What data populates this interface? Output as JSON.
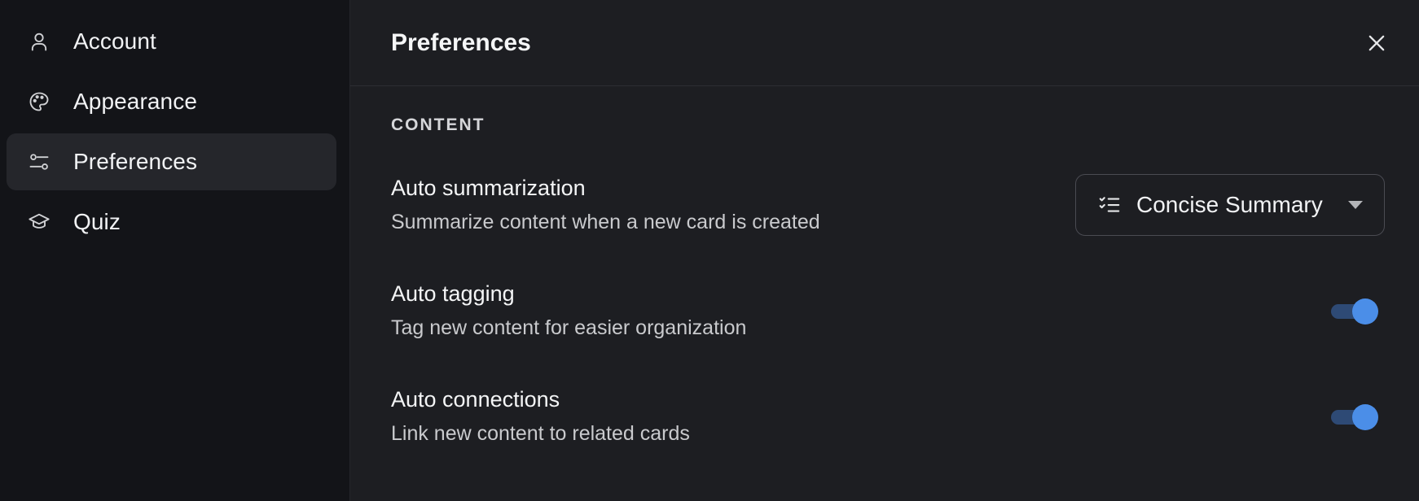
{
  "sidebar": {
    "items": [
      {
        "label": "Account",
        "icon": "user-icon",
        "active": false
      },
      {
        "label": "Appearance",
        "icon": "palette-icon",
        "active": false
      },
      {
        "label": "Preferences",
        "icon": "sliders-icon",
        "active": true
      },
      {
        "label": "Quiz",
        "icon": "graduation-cap-icon",
        "active": false
      }
    ]
  },
  "header": {
    "title": "Preferences",
    "close_icon": "close-icon"
  },
  "content": {
    "section_label": "CONTENT",
    "settings": [
      {
        "title": "Auto summarization",
        "description": "Summarize content when a new card is created",
        "control": "dropdown",
        "value": "Concise Summary",
        "icon": "list-check-icon"
      },
      {
        "title": "Auto tagging",
        "description": "Tag new content for easier organization",
        "control": "toggle",
        "enabled": true
      },
      {
        "title": "Auto connections",
        "description": "Link new content to related cards",
        "control": "toggle",
        "enabled": true
      }
    ]
  },
  "colors": {
    "sidebar_bg": "#131418",
    "main_bg": "#1d1e22",
    "active_item_bg": "#25262b",
    "toggle_knob": "#4b8ee8",
    "toggle_track": "#2e4a75"
  }
}
